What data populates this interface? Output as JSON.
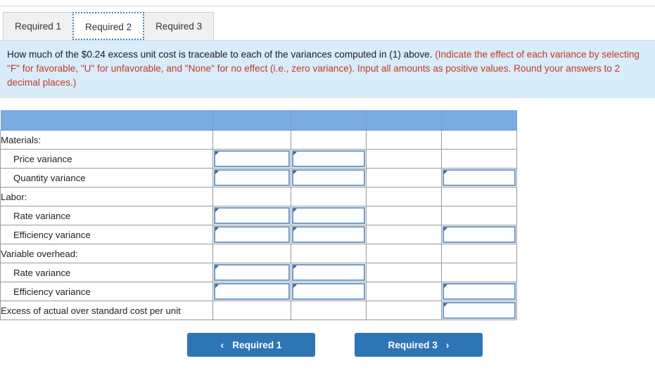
{
  "tabs": [
    {
      "label": "Required 1",
      "active": false
    },
    {
      "label": "Required 2",
      "active": true
    },
    {
      "label": "Required 3",
      "active": false
    }
  ],
  "instructions": {
    "lead": "How much of the $0.24 excess unit cost is traceable to each of the variances computed in (1) above. ",
    "highlight": "(Indicate the effect of each variance by selecting \"F\" for favorable, \"U\" for unfavorable, and \"None\" for no effect (i.e., zero variance). Input all amounts as positive values. Round your answers to 2 decimal places.)"
  },
  "table": {
    "headers": [
      "",
      "",
      "",
      "",
      ""
    ],
    "rows": [
      {
        "label": "Materials:",
        "indent": false,
        "fields": [
          false,
          false,
          false,
          false
        ]
      },
      {
        "label": "Price variance",
        "indent": true,
        "fields": [
          true,
          true,
          false,
          false
        ]
      },
      {
        "label": "Quantity variance",
        "indent": true,
        "fields": [
          true,
          true,
          false,
          true
        ]
      },
      {
        "label": "Labor:",
        "indent": false,
        "fields": [
          false,
          false,
          false,
          false
        ]
      },
      {
        "label": "Rate variance",
        "indent": true,
        "fields": [
          true,
          true,
          false,
          false
        ]
      },
      {
        "label": "Efficiency variance",
        "indent": true,
        "fields": [
          true,
          true,
          false,
          true
        ]
      },
      {
        "label": "Variable overhead:",
        "indent": false,
        "fields": [
          false,
          false,
          false,
          false
        ]
      },
      {
        "label": "Rate variance",
        "indent": true,
        "fields": [
          true,
          true,
          false,
          false
        ]
      },
      {
        "label": "Efficiency variance",
        "indent": true,
        "fields": [
          true,
          true,
          false,
          true
        ]
      },
      {
        "label": "Excess of actual over standard cost per unit",
        "indent": false,
        "fields": [
          false,
          false,
          false,
          true
        ]
      }
    ]
  },
  "nav": {
    "prev_label": "Required 1",
    "next_label": "Required 3",
    "prev_icon": "chevron-left-icon",
    "next_icon": "chevron-right-icon",
    "prev_chevron": "‹",
    "next_chevron": "›"
  },
  "colors": {
    "header_blue": "#7aabe3",
    "banner_bg": "#d9ecf9",
    "button_blue": "#2e75b6",
    "highlight_text": "#c0392b",
    "input_border": "#6f9bc8"
  }
}
